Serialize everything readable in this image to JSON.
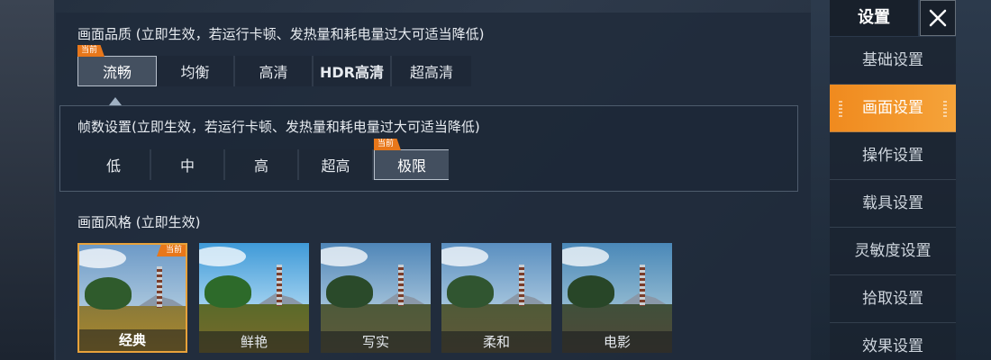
{
  "quality": {
    "title": "画面品质 (立即生效，若运行卡顿、发热量和耗电量过大可适当降低)",
    "badge": "当前",
    "options": [
      "流畅",
      "均衡",
      "高清",
      "HDR高清",
      "超高清"
    ],
    "selected": "流畅"
  },
  "fps": {
    "title": "帧数设置(立即生效，若运行卡顿、发热量和耗电量过大可适当降低)",
    "badge": "当前",
    "options": [
      "低",
      "中",
      "高",
      "超高",
      "极限"
    ],
    "selected": "极限"
  },
  "style": {
    "title": "画面风格 (立即生效)",
    "badge": "当前",
    "options": [
      "经典",
      "鲜艳",
      "写实",
      "柔和",
      "电影"
    ],
    "selected": "经典"
  },
  "sidebar": {
    "title": "设置",
    "close_icon": "close-icon",
    "items": [
      {
        "label": "基础设置"
      },
      {
        "label": "画面设置"
      },
      {
        "label": "操作设置"
      },
      {
        "label": "载具设置"
      },
      {
        "label": "灵敏度设置"
      },
      {
        "label": "拾取设置"
      },
      {
        "label": "效果设置"
      }
    ],
    "active": "画面设置"
  },
  "colors": {
    "accent": "#f08a1e",
    "badge": "#e8771a",
    "selected_border": "#b8c1cc"
  }
}
